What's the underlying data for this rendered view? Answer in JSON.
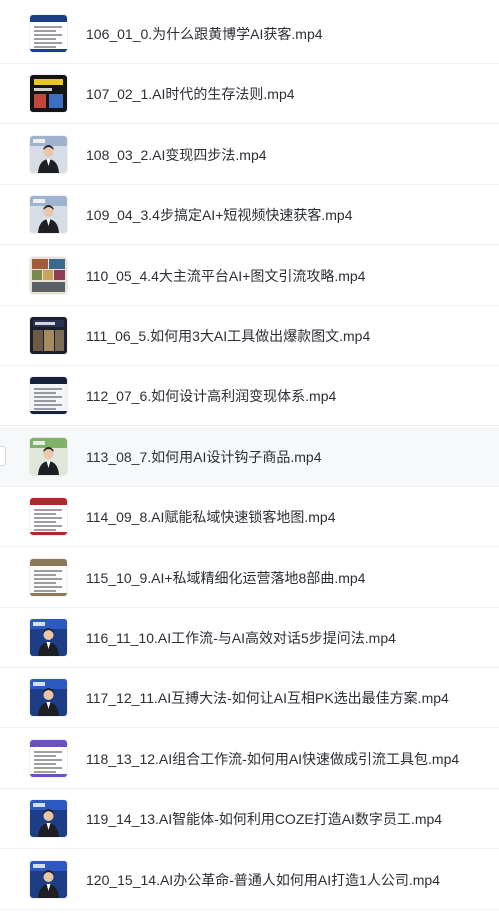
{
  "files": [
    {
      "name": "106_01_0.为什么跟黄博学AI获客.mp4",
      "thumb": "video-thumbnail-doc"
    },
    {
      "name": "107_02_1.AI时代的生存法则.mp4",
      "thumb": "video-thumbnail-dark"
    },
    {
      "name": "108_03_2.AI变现四步法.mp4",
      "thumb": "video-thumbnail-presenter"
    },
    {
      "name": "109_04_3.4步搞定AI+短视频快速获客.mp4",
      "thumb": "video-thumbnail-presenter"
    },
    {
      "name": "110_05_4.4大主流平台AI+图文引流攻略.mp4",
      "thumb": "video-thumbnail-collage"
    },
    {
      "name": "111_06_5.如何用3大AI工具做出爆款图文.mp4",
      "thumb": "video-thumbnail-collage-dark"
    },
    {
      "name": "112_07_6.如何设计高利润变现体系.mp4",
      "thumb": "video-thumbnail-doc-dark"
    },
    {
      "name": "113_08_7.如何用AI设计钩子商品.mp4",
      "thumb": "video-thumbnail-presenter-green"
    },
    {
      "name": "114_09_8.AI赋能私域快速锁客地图.mp4",
      "thumb": "video-thumbnail-doc-red"
    },
    {
      "name": "115_10_9.AI+私域精细化运营落地8部曲.mp4",
      "thumb": "video-thumbnail-doc-light"
    },
    {
      "name": "116_11_10.AI工作流-与AI高效对话5步提问法.mp4",
      "thumb": "video-thumbnail-presenter-blue"
    },
    {
      "name": "117_12_11.AI互搏大法-如何让AI互相PK选出最佳方案.mp4",
      "thumb": "video-thumbnail-presenter-blue"
    },
    {
      "name": "118_13_12.AI组合工作流-如何用AI快速做成引流工具包.mp4",
      "thumb": "video-thumbnail-doc-purple"
    },
    {
      "name": "119_14_13.AI智能体-如何利用COZE打造AI数字员工.mp4",
      "thumb": "video-thumbnail-presenter-blue"
    },
    {
      "name": "120_15_14.AI办公革命-普通人如何用AI打造1人公司.mp4",
      "thumb": "video-thumbnail-presenter-blue"
    }
  ],
  "hover_index": 7,
  "colors": {
    "text": "#2b2f36",
    "divider": "#eef0f3",
    "hover_bg": "#f7f8fa"
  }
}
